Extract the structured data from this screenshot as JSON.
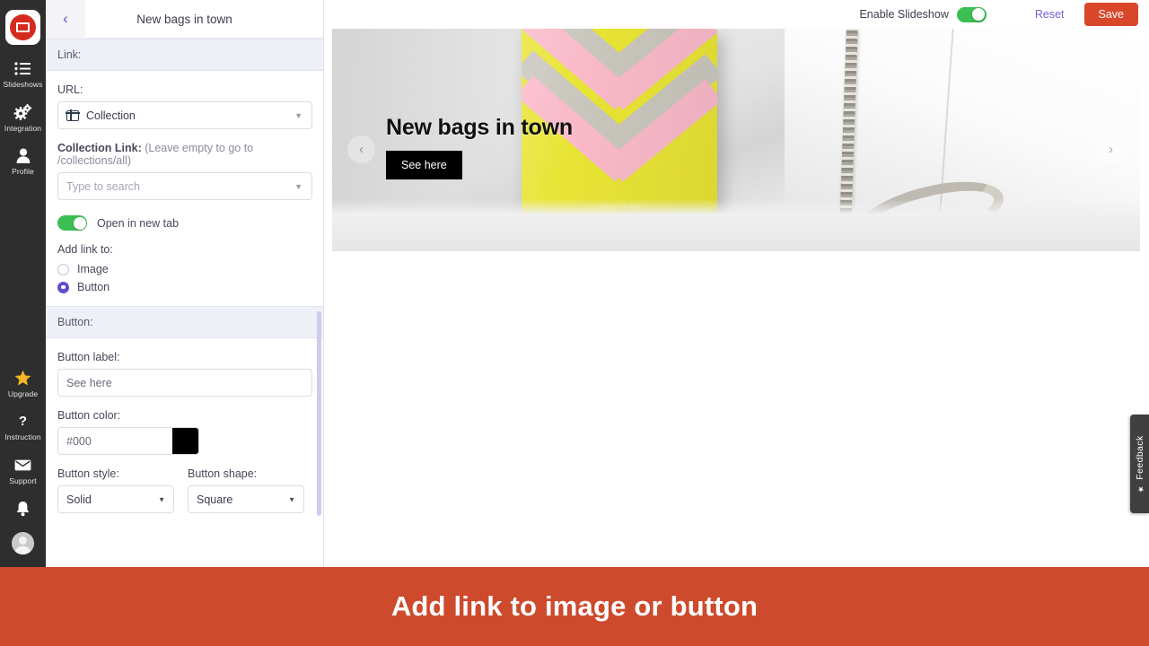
{
  "sidebar": {
    "logo": "slideshow-app-logo",
    "items": [
      {
        "label": "Slideshows",
        "icon": "list-icon"
      },
      {
        "label": "Integration",
        "icon": "gears-icon"
      },
      {
        "label": "Profile",
        "icon": "user-icon"
      }
    ],
    "bottom_items": [
      {
        "label": "Upgrade",
        "icon": "star-icon"
      },
      {
        "label": "Instruction",
        "icon": "question-mark-icon"
      },
      {
        "label": "Support",
        "icon": "envelope-icon"
      }
    ],
    "bell": "bell-icon",
    "avatar": "avatar-icon"
  },
  "panel": {
    "back": "‹",
    "title": "New bags in town",
    "link_section": "Link:",
    "url_label": "URL:",
    "url_value": "Collection",
    "url_icon": "collection-icon",
    "collection_link_label_strong": "Collection Link:",
    "collection_link_label_muted": " (Leave empty to go to /collections/all)",
    "collection_link_placeholder": "Type to search",
    "open_new_tab_label": "Open in new tab",
    "open_new_tab_on": true,
    "add_link_to_label": "Add link to:",
    "radios": [
      {
        "label": "Image",
        "selected": false
      },
      {
        "label": "Button",
        "selected": true
      }
    ],
    "button_section": "Button:",
    "button_label_label": "Button label:",
    "button_label_value": "See here",
    "button_color_label": "Button color:",
    "button_color_value": "#000",
    "button_color_swatch": "#000000",
    "button_style_label": "Button style:",
    "button_style_value": "Solid",
    "button_shape_label": "Button shape:",
    "button_shape_value": "Square"
  },
  "topbar": {
    "enable_slideshow_label": "Enable Slideshow",
    "enable_slideshow_on": true,
    "reset_label": "Reset",
    "save_label": "Save",
    "save_color": "#d9472b"
  },
  "slide": {
    "caption": "New bags in town",
    "button_label": "See here",
    "prev": "‹",
    "next": "›",
    "brand_text": "LOVELY KARD"
  },
  "feedback": {
    "label": "Feedback",
    "star": "★"
  },
  "banner": {
    "text": "Add link to image or button",
    "color": "#cd4a2c"
  }
}
